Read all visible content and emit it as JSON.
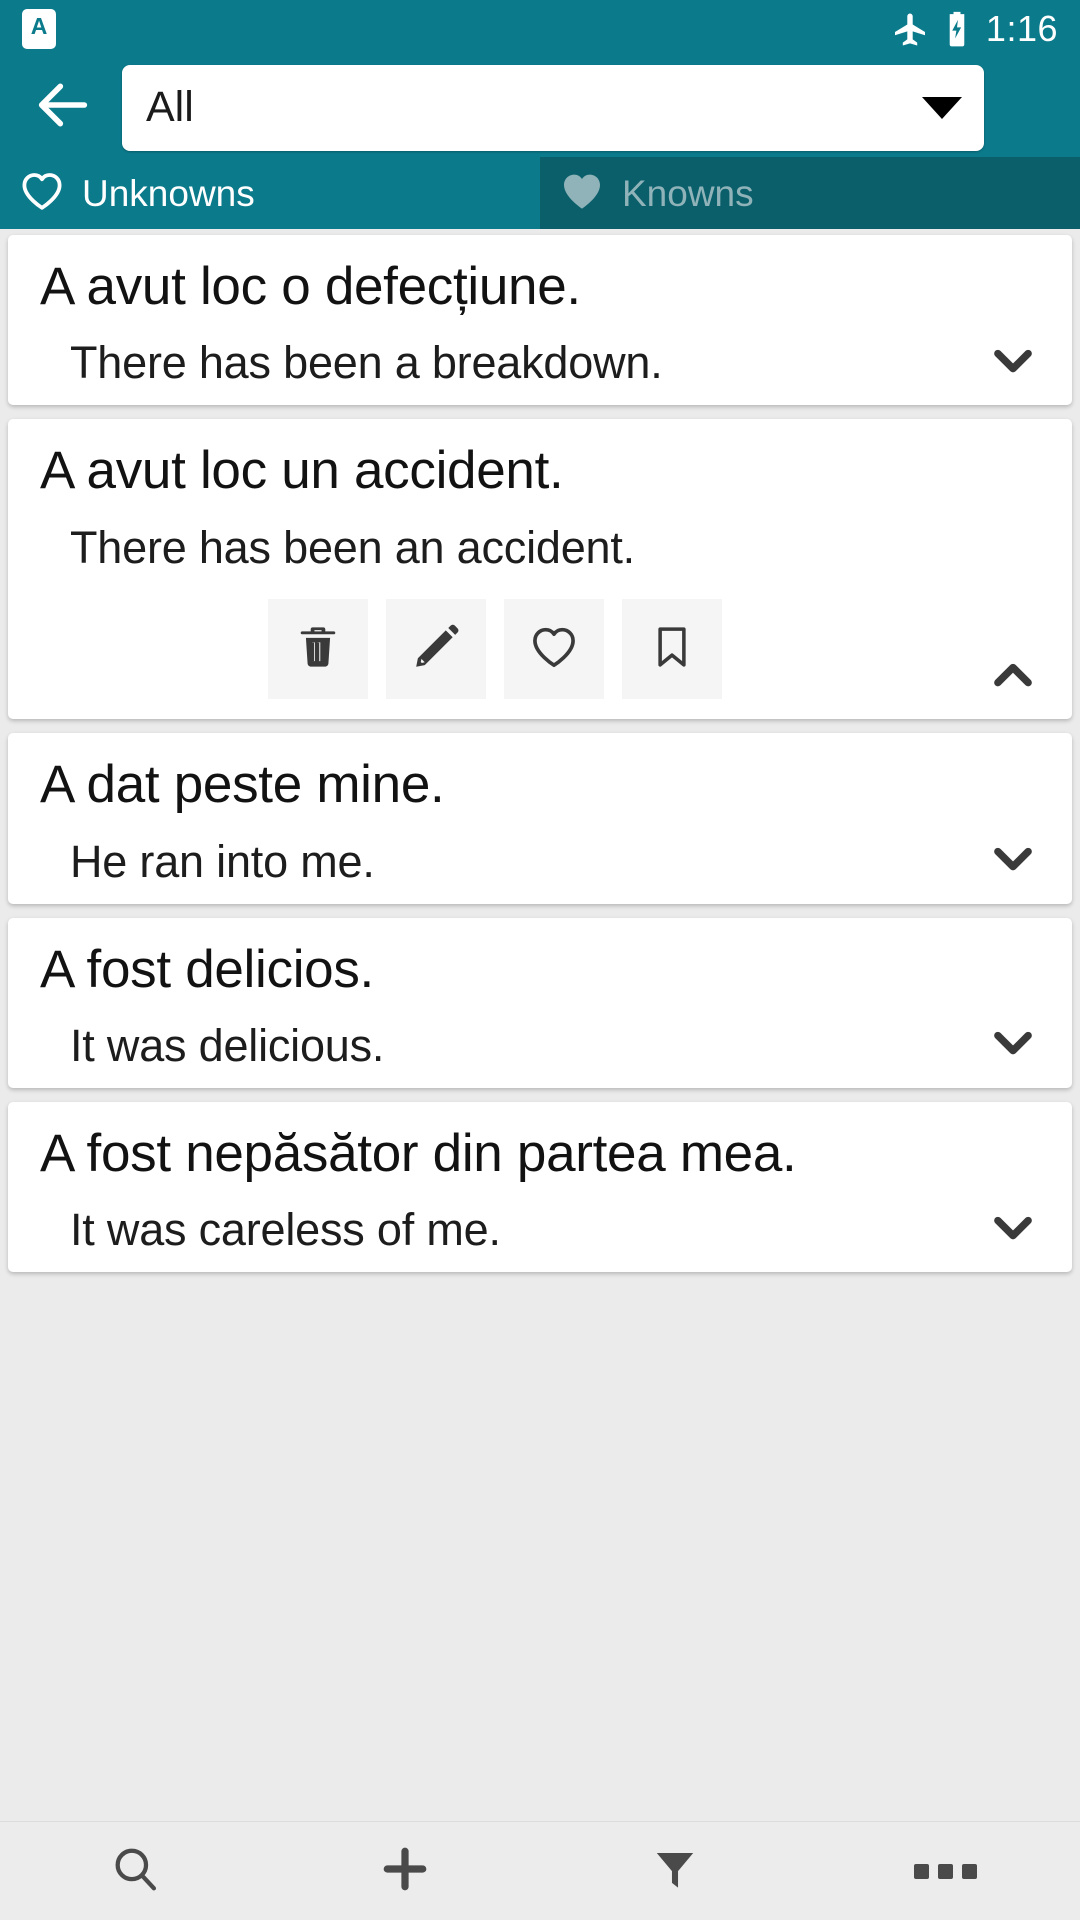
{
  "theme": {
    "accent": "#0b7b8c",
    "accent_dark": "#0a5f6b",
    "page_bg": "#ebebeb",
    "card_bg": "#ffffff",
    "icon_dark": "#3a3a3a",
    "inactive_text": "#8fb3b8"
  },
  "status_bar": {
    "app_icon": "app-notification-icon",
    "app_icon_letter": "A",
    "airplane_icon": "airplane-mode-icon",
    "battery_icon": "battery-charging-icon",
    "clock": "1:16"
  },
  "app_bar": {
    "back_icon": "arrow-left-icon",
    "filter_spinner": {
      "icon": "chevron-down-icon",
      "value": "All",
      "placeholder": "All",
      "options": [
        "All"
      ]
    }
  },
  "tabs": [
    {
      "label": "Unknowns",
      "icon": "heart-outline-icon",
      "active": true
    },
    {
      "label": "Knowns",
      "icon": "heart-filled-icon",
      "active": false
    }
  ],
  "cards": [
    {
      "front": "A avut loc o defecțiune.",
      "back": "There has been a breakdown.",
      "expanded": false,
      "toggle_icon": "chevron-down-icon",
      "back_narrow": true
    },
    {
      "front": "A avut loc un accident.",
      "back": "There has been an accident.",
      "expanded": true,
      "toggle_icon": "chevron-up-icon",
      "back_narrow": false,
      "actions": [
        {
          "name": "delete-button",
          "icon": "trash-icon"
        },
        {
          "name": "edit-button",
          "icon": "pencil-icon"
        },
        {
          "name": "favorite-button",
          "icon": "heart-outline-icon"
        },
        {
          "name": "bookmark-button",
          "icon": "bookmark-outline-icon"
        }
      ]
    },
    {
      "front": "A dat peste mine.",
      "back": "He ran into me.",
      "expanded": false,
      "toggle_icon": "chevron-down-icon",
      "back_narrow": false
    },
    {
      "front": "A fost delicios.",
      "back": "It was delicious.",
      "expanded": false,
      "toggle_icon": "chevron-down-icon",
      "back_narrow": false
    },
    {
      "front": "A fost nepăsător din partea mea.",
      "back": "It was careless of me.",
      "expanded": false,
      "toggle_icon": "chevron-down-icon",
      "back_narrow": false
    }
  ],
  "bottom_nav": [
    {
      "name": "search-button",
      "icon": "search-icon"
    },
    {
      "name": "add-button",
      "icon": "plus-icon"
    },
    {
      "name": "filter-button",
      "icon": "funnel-icon"
    },
    {
      "name": "more-button",
      "icon": "overflow-dots-icon"
    }
  ]
}
